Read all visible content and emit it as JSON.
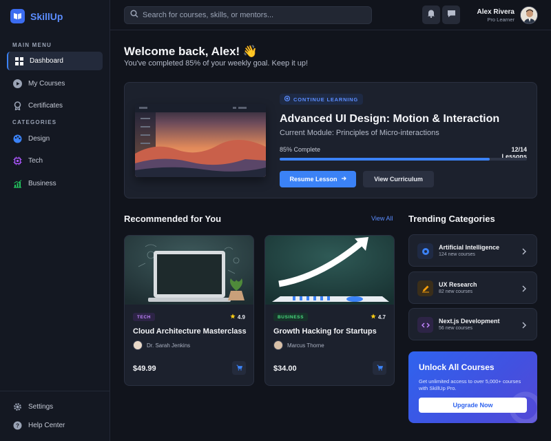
{
  "brand": {
    "name": "SkillUp"
  },
  "sidebar": {
    "main_menu_label": "MAIN MENU",
    "categories_label": "CATEGORIES",
    "main_items": [
      {
        "label": "Dashboard",
        "icon": "grid-icon",
        "active": true
      },
      {
        "label": "My Courses",
        "icon": "play-circle-icon"
      },
      {
        "label": "Certificates",
        "icon": "award-icon"
      }
    ],
    "category_items": [
      {
        "label": "Design",
        "icon": "palette-icon"
      },
      {
        "label": "Tech",
        "icon": "chip-icon"
      },
      {
        "label": "Business",
        "icon": "chart-icon"
      }
    ],
    "bottom_items": [
      {
        "label": "Settings",
        "icon": "gear-icon"
      },
      {
        "label": "Help Center",
        "icon": "help-icon"
      }
    ]
  },
  "topbar": {
    "search_placeholder": "Search for courses, skills, or mentors...",
    "user": {
      "name": "Alex Rivera",
      "role": "Pro Learner"
    }
  },
  "welcome": {
    "title": "Welcome back, Alex! 👋",
    "subtitle": "You've completed 85% of your weekly goal. Keep it up!"
  },
  "continue": {
    "pill": "CONTINUE LEARNING",
    "title": "Advanced UI Design: Motion & Interaction",
    "module": "Current Module: Principles of Micro-interactions",
    "percent_label": "85% Complete",
    "lessons_label": "12/14 Lessons",
    "progress": 0.85,
    "resume_label": "Resume Lesson",
    "curriculum_label": "View Curriculum"
  },
  "recommended": {
    "title": "Recommended for You",
    "view_all": "View All",
    "courses": [
      {
        "tag": "TECH",
        "rating": "4.9",
        "title": "Cloud Architecture Masterclass",
        "author": "Dr. Sarah Jenkins",
        "price": "$49.99"
      },
      {
        "tag": "BUSINESS",
        "rating": "4.7",
        "title": "Growth Hacking for Startups",
        "author": "Marcus Thorne",
        "price": "$34.00"
      }
    ]
  },
  "trending": {
    "title": "Trending Categories",
    "items": [
      {
        "name": "Artificial Intelligence",
        "count": "124 new courses",
        "icon": "brain-icon"
      },
      {
        "name": "UX Research",
        "count": "82 new courses",
        "icon": "pencil-icon"
      },
      {
        "name": "Next.js Development",
        "count": "56 new courses",
        "icon": "code-icon"
      }
    ]
  },
  "promo": {
    "title": "Unlock All Courses",
    "text": "Get unlimited access to over 5,000+ courses with SkillUp Pro.",
    "button": "Upgrade Now"
  }
}
